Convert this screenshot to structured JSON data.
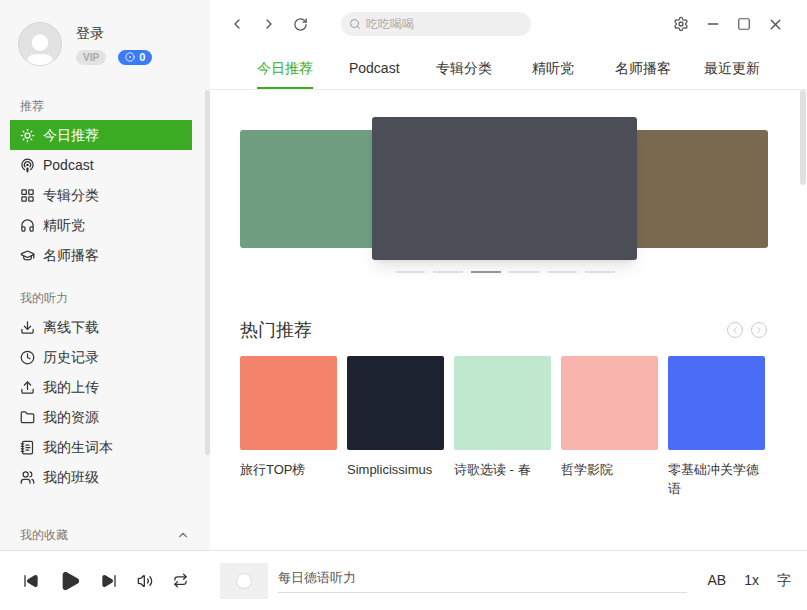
{
  "user": {
    "login": "登录",
    "vip": "VIP",
    "coins": "0"
  },
  "search": {
    "placeholder": "吃吃喝喝"
  },
  "sidebar": {
    "sections": [
      {
        "title": "推荐",
        "items": [
          {
            "label": "今日推荐",
            "selected": true
          },
          {
            "label": "Podcast",
            "selected": false
          },
          {
            "label": "专辑分类",
            "selected": false
          },
          {
            "label": "精听党",
            "selected": false
          },
          {
            "label": "名师播客",
            "selected": false
          }
        ]
      },
      {
        "title": "我的听力",
        "items": [
          {
            "label": "离线下载",
            "selected": false
          },
          {
            "label": "历史记录",
            "selected": false
          },
          {
            "label": "我的上传",
            "selected": false
          },
          {
            "label": "我的资源",
            "selected": false
          },
          {
            "label": "我的生词本",
            "selected": false
          },
          {
            "label": "我的班级",
            "selected": false
          }
        ]
      }
    ],
    "collapsible": {
      "title": "我的收藏",
      "expanded": true
    }
  },
  "tabs": [
    {
      "label": "今日推荐",
      "selected": true
    },
    {
      "label": "Podcast",
      "selected": false
    },
    {
      "label": "专辑分类",
      "selected": false
    },
    {
      "label": "精听党",
      "selected": false
    },
    {
      "label": "名师播客",
      "selected": false
    },
    {
      "label": "最近更新",
      "selected": false
    }
  ],
  "banner": {
    "slides": [
      {
        "color": "#6f9f80"
      },
      {
        "color": "#4b4e57"
      },
      {
        "color": "#7b6a4f"
      }
    ],
    "dots": [
      {
        "selected": false
      },
      {
        "selected": false
      },
      {
        "selected": true
      },
      {
        "selected": false
      },
      {
        "selected": false
      },
      {
        "selected": false
      }
    ]
  },
  "hot": {
    "title": "热门推荐",
    "albums": [
      {
        "title": "旅行TOP榜",
        "color": "#f3836a"
      },
      {
        "title": "Simplicissimus",
        "color": "#1c2230"
      },
      {
        "title": "诗歌选读 - 春",
        "color": "#bfe8cf"
      },
      {
        "title": "哲学影院",
        "color": "#f7b5ad"
      },
      {
        "title": "零基础冲关学德语",
        "color": "#4a6cf7"
      }
    ]
  },
  "player": {
    "track": "每日德语听力",
    "level": 0,
    "ab": "AB",
    "speed": "1x",
    "lyrics": "字"
  }
}
